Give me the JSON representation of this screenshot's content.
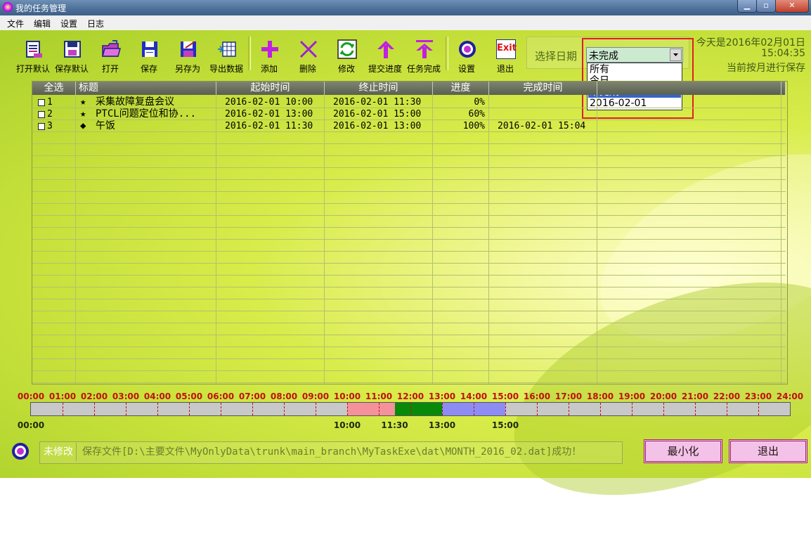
{
  "window": {
    "title": "我的任务管理"
  },
  "menu": [
    "文件",
    "编辑",
    "设置",
    "日志"
  ],
  "toolbar": {
    "open_default": "打开默认",
    "save_default": "保存默认",
    "open": "打开",
    "save": "保存",
    "save_as": "另存为",
    "export": "导出数据",
    "add": "添加",
    "delete": "删除",
    "modify": "修改",
    "submit_progress": "提交进度",
    "task_complete": "任务完成",
    "settings": "设置",
    "exit": "退出",
    "exit_icon_text": "Exit"
  },
  "date_select": {
    "label": "选择日期",
    "value": "未完成",
    "options": [
      "所有",
      "今日",
      "未完成",
      "2016-02-01"
    ],
    "selected_index": 2
  },
  "info": {
    "today": "今天是2016年02月01日",
    "time": "15:04:35",
    "save_mode": "当前按月进行保存"
  },
  "table": {
    "headers": [
      "全选",
      "标题",
      "起始时间",
      "终止时间",
      "进度",
      "完成时间"
    ],
    "rows": [
      {
        "id": "1",
        "mark": "★",
        "title": "采集故障复盘会议",
        "start": "2016-02-01 10:00",
        "end": "2016-02-01 11:30",
        "progress": "0%",
        "done": ""
      },
      {
        "id": "2",
        "mark": "★",
        "title": "PTCL问题定位和协...",
        "start": "2016-02-01 13:00",
        "end": "2016-02-01 15:00",
        "progress": "60%",
        "done": ""
      },
      {
        "id": "3",
        "mark": "◆",
        "title": "午饭",
        "start": "2016-02-01 11:30",
        "end": "2016-02-01 13:00",
        "progress": "100%",
        "done": "2016-02-01 15:04"
      }
    ]
  },
  "timeline": {
    "hours": [
      "00:00",
      "01:00",
      "02:00",
      "03:00",
      "04:00",
      "05:00",
      "06:00",
      "07:00",
      "08:00",
      "09:00",
      "10:00",
      "11:00",
      "12:00",
      "13:00",
      "14:00",
      "15:00",
      "16:00",
      "17:00",
      "18:00",
      "19:00",
      "20:00",
      "21:00",
      "22:00",
      "23:00",
      "24:00"
    ],
    "segments": [
      {
        "start": 10.0,
        "end": 11.5,
        "color": "#f4919a"
      },
      {
        "start": 11.5,
        "end": 13.0,
        "color": "#088a08"
      },
      {
        "start": 13.0,
        "end": 15.0,
        "color": "#8c8cf4"
      }
    ],
    "markers": [
      "00:00",
      "10:00",
      "11:30",
      "13:00",
      "15:00"
    ],
    "marker_hours": [
      0,
      10,
      11.5,
      13,
      15
    ]
  },
  "status": {
    "state": "未修改",
    "message": "保存文件[D:\\主要文件\\MyOnlyData\\trunk\\main_branch\\MyTaskExe\\dat\\MONTH_2016_02.dat]成功！"
  },
  "buttons": {
    "minimize": "最小化",
    "exit": "退出"
  }
}
